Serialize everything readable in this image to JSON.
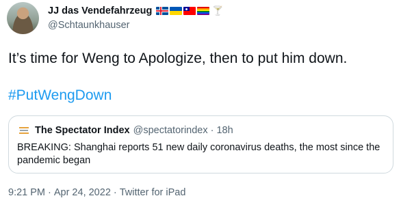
{
  "author": {
    "display_name": "JJ das Vendefahrzeug",
    "handle": "@Schtaunkhauser",
    "flags": [
      "iceland-flag",
      "ukraine-flag",
      "taiwan-flag",
      "rainbow-flag",
      "cocktail-glass-icon"
    ]
  },
  "tweet": {
    "text": "It’s time for Weng to Apologize, then to put him down.",
    "hashtag": "#PutWengDown"
  },
  "quoted_tweet": {
    "display_name": "The Spectator Index",
    "handle": "@spectatorindex",
    "separator": "·",
    "time": "18h",
    "text": "BREAKING: Shanghai reports 51 new daily coronavirus deaths, the most since the pandemic began"
  },
  "meta": {
    "time": "9:21 PM",
    "separator": "·",
    "date": "Apr 24, 2022",
    "source": "Twitter for iPad"
  },
  "colors": {
    "link": "#1d9bf0",
    "secondary_text": "#536471",
    "border": "#cfd9de"
  }
}
